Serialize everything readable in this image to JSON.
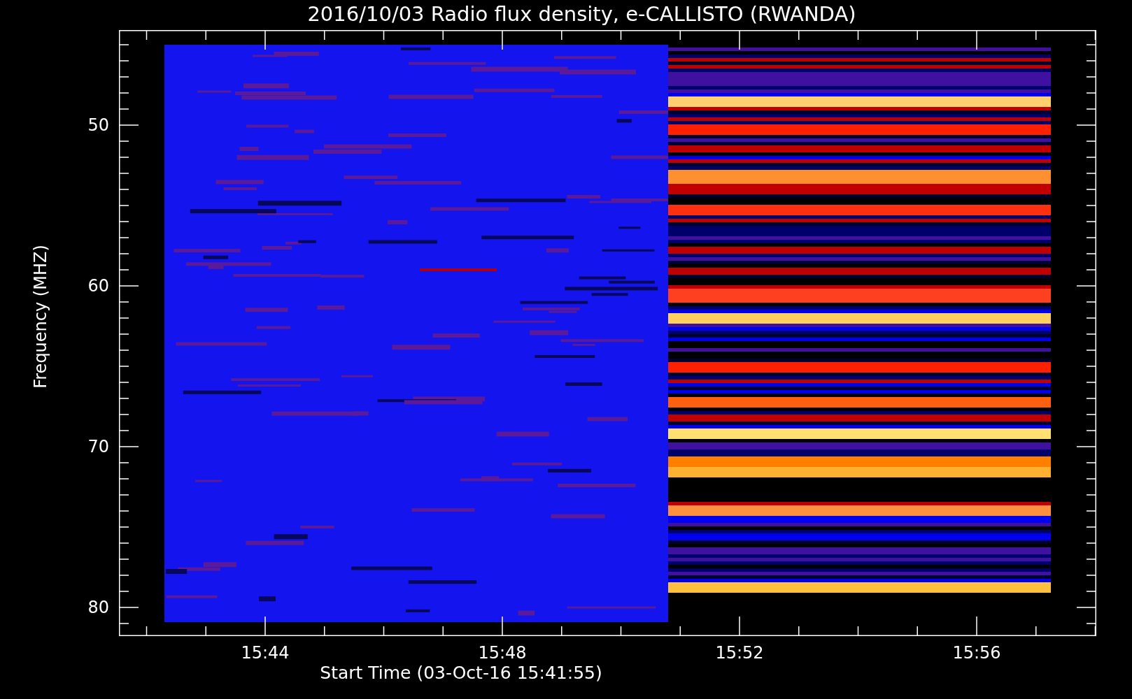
{
  "title": "2016/10/03  Radio flux density, e-CALLISTO (RWANDA)",
  "y_axis": {
    "label": "Frequency (MHZ)",
    "ticks": [
      "50",
      "60",
      "70",
      "80"
    ]
  },
  "x_axis": {
    "label": "Start Time (03-Oct-16 15:41:55)",
    "ticks": [
      "15:44",
      "15:48",
      "15:52",
      "15:56"
    ]
  }
}
